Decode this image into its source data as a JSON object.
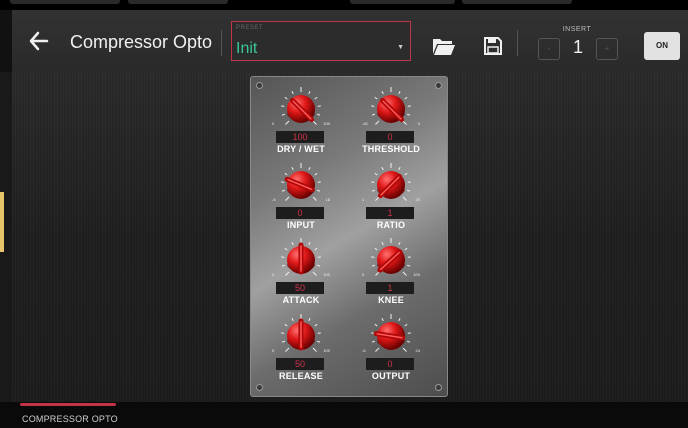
{
  "header": {
    "title": "Compressor Opto",
    "preset": {
      "label": "PRESET",
      "value": "Init"
    },
    "insert": {
      "label": "INSERT",
      "value": "1",
      "minus": "-",
      "plus": "+"
    },
    "on_label": "ON"
  },
  "knobs": [
    {
      "name": "DRY / WET",
      "value": "100",
      "min": "0",
      "max": "100",
      "level": 1.0
    },
    {
      "name": "THRESHOLD",
      "value": "0",
      "min": "-40",
      "max": "0",
      "level": 1.0
    },
    {
      "name": "INPUT",
      "value": "0",
      "min": "-6",
      "max": "18",
      "level": 0.25
    },
    {
      "name": "RATIO",
      "value": "1",
      "min": "1",
      "max": "20",
      "level": 0.0
    },
    {
      "name": "ATTACK",
      "value": "50",
      "min": "0",
      "max": "100",
      "level": 0.5
    },
    {
      "name": "KNEE",
      "value": "1",
      "min": "0",
      "max": "100",
      "level": 0.01
    },
    {
      "name": "RELEASE",
      "value": "50",
      "min": "0",
      "max": "100",
      "level": 0.5
    },
    {
      "name": "OUTPUT",
      "value": "0",
      "min": "-6",
      "max": "24",
      "level": 0.2
    }
  ],
  "footer": {
    "tab_label": "COMPRESSOR OPTO"
  },
  "colors": {
    "accent": "#c2344a",
    "preset_text": "#38c79a",
    "knob_red": "#e01818",
    "value_text": "#d2324a"
  },
  "icons": {
    "back": "arrow-left-icon",
    "load": "folder-icon",
    "save": "floppy-disk-icon",
    "dropdown": "triangle-down-icon"
  }
}
